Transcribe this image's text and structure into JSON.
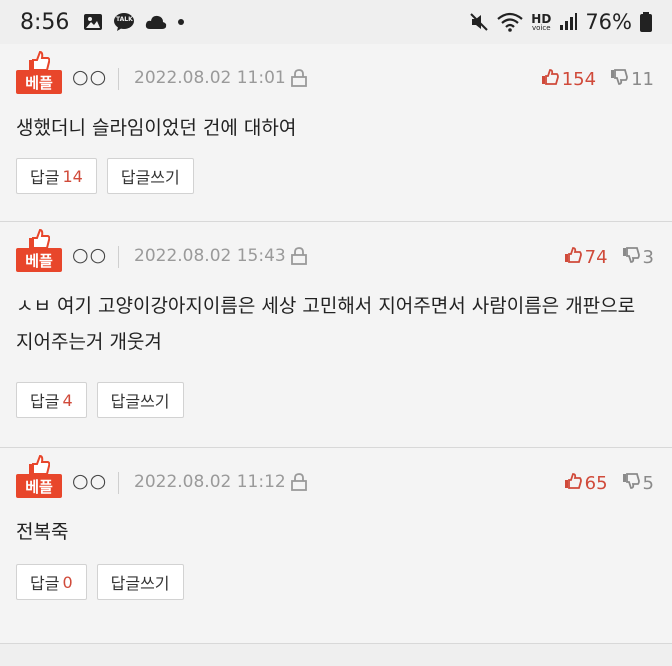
{
  "status": {
    "time": "8:56",
    "battery": "76%",
    "icons": [
      "gallery-icon",
      "talk-icon",
      "cloud-icon",
      "dot-icon",
      "mute-icon",
      "wifi-icon",
      "hd-voice-icon",
      "signal-icon",
      "battery-icon"
    ],
    "hd_top": "HD",
    "hd_bottom": "voice",
    "talk_label": "TALK"
  },
  "colors": {
    "accent": "#e8462b",
    "like": "#d04a3a",
    "dislike": "#8a8a8a",
    "meta": "#9a9a9a"
  },
  "best_label": "베플",
  "reply_label": "답글",
  "write_reply_label": "답글쓰기",
  "comments": [
    {
      "nickname": "○○",
      "date": "2022.08.02 11:01",
      "likes": "154",
      "dislikes": "11",
      "text": "생했더니 슬라임이었던 건에 대하여",
      "reply_count": "14"
    },
    {
      "nickname": "○○",
      "date": "2022.08.02 15:43",
      "likes": "74",
      "dislikes": "3",
      "text": "ㅅㅂ 여기 고양이강아지이름은 세상 고민해서 지어주면서 사람이름은 개판으로 지어주는거 개웃겨",
      "reply_count": "4"
    },
    {
      "nickname": "○○",
      "date": "2022.08.02 11:12",
      "likes": "65",
      "dislikes": "5",
      "text": "전복죽",
      "reply_count": "0"
    }
  ]
}
